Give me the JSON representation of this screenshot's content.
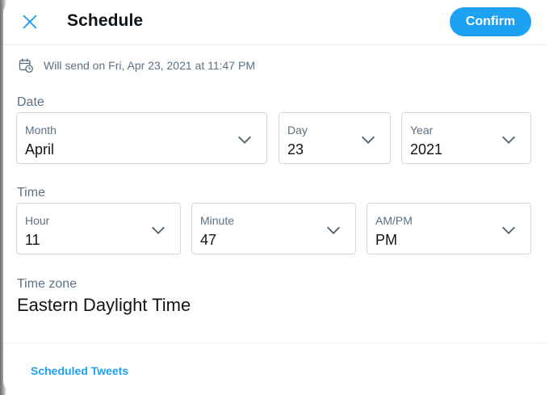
{
  "header": {
    "close_icon": "close-icon",
    "title": "Schedule",
    "confirm_label": "Confirm"
  },
  "send_info": {
    "icon": "calendar-clock-icon",
    "text": "Will send on Fri, Apr 23, 2021 at 11:47 PM"
  },
  "date": {
    "label": "Date",
    "month": {
      "label": "Month",
      "value": "April"
    },
    "day": {
      "label": "Day",
      "value": "23"
    },
    "year": {
      "label": "Year",
      "value": "2021"
    }
  },
  "time": {
    "label": "Time",
    "hour": {
      "label": "Hour",
      "value": "11"
    },
    "minute": {
      "label": "Minute",
      "value": "47"
    },
    "ampm": {
      "label": "AM/PM",
      "value": "PM"
    }
  },
  "timezone": {
    "label": "Time zone",
    "value": "Eastern Daylight Time"
  },
  "footer": {
    "scheduled_link": "Scheduled Tweets"
  },
  "colors": {
    "accent": "#1da1f2",
    "text_primary": "#0f1419",
    "text_secondary": "#5b7083",
    "border": "#cfd9de"
  }
}
